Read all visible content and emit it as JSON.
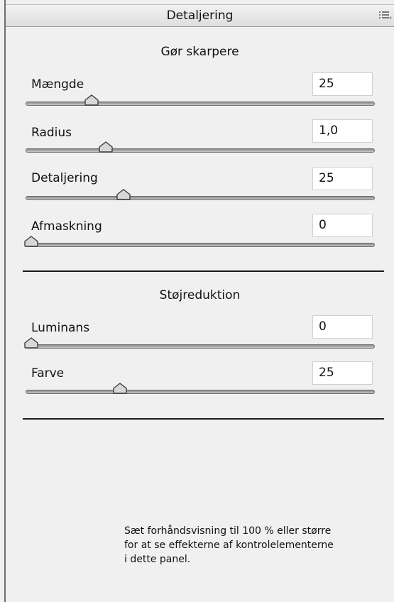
{
  "panel": {
    "title": "Detaljering",
    "menu_icon": "panel-menu-icon"
  },
  "sharpening": {
    "heading": "Gør skarpere",
    "sliders": [
      {
        "label": "Mængde",
        "value": "25",
        "position": 0.19
      },
      {
        "label": "Radius",
        "value": "1,0",
        "position": 0.23
      },
      {
        "label": "Detaljering",
        "value": "25",
        "position": 0.28
      },
      {
        "label": "Afmaskning",
        "value": "0",
        "position": 0.0
      }
    ]
  },
  "noise_reduction": {
    "heading": "Støjreduktion",
    "sliders": [
      {
        "label": "Luminans",
        "value": "0",
        "position": 0.0
      },
      {
        "label": "Farve",
        "value": "25",
        "position": 0.27
      }
    ]
  },
  "note": "Sæt forhåndsvisning til 100 % eller større for at se effekterne af kontrolelementerne i dette panel.",
  "colors": {
    "panel_background": "#f0f0f0",
    "divider": "#1b1b1b"
  }
}
